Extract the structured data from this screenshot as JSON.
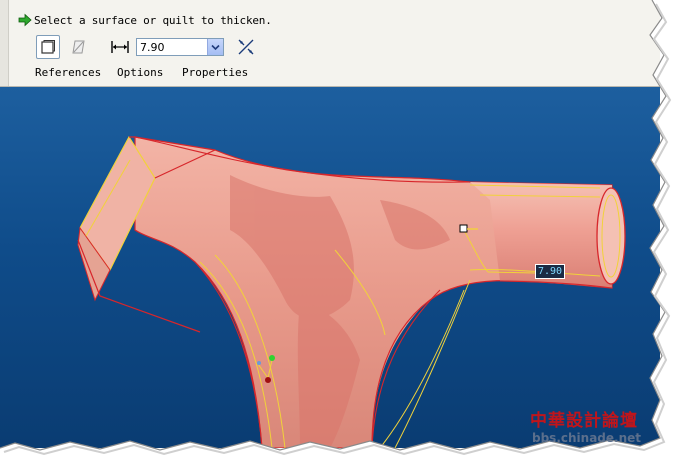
{
  "dashboard": {
    "prompt": "Select a surface or quilt to thicken.",
    "thickness_value": "7.90",
    "tabs": [
      {
        "label": "References"
      },
      {
        "label": "Options"
      },
      {
        "label": "Properties"
      }
    ],
    "icons": [
      "green-arrow-icon",
      "solid-thicken-icon",
      "remove-material-icon",
      "dimension-icon",
      "chevron-down-icon",
      "flip-direction-icon"
    ]
  },
  "viewport": {
    "dimension_label": "7.90",
    "colors": {
      "background": "#0f4c8a",
      "model": "#e9a093",
      "edge": "#d7262b",
      "datum": "#f1d23a"
    }
  },
  "watermark": {
    "chinese_text": "中華設計論壇",
    "url": "bbs.chinade.net"
  }
}
